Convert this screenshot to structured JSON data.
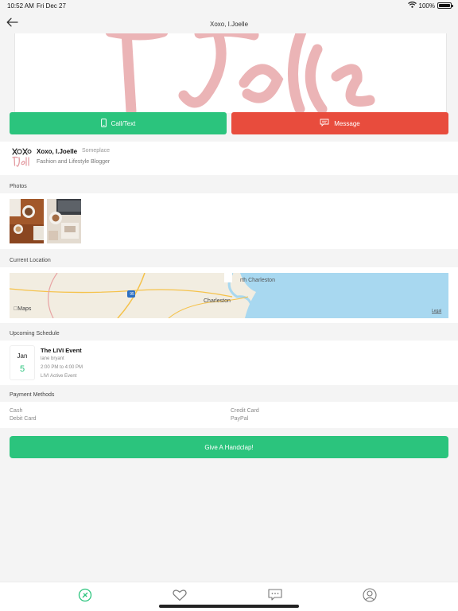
{
  "status_bar": {
    "time": "10:52 AM",
    "date": "Fri Dec 27",
    "battery": "100%",
    "battery_level": 1.0
  },
  "nav": {
    "title": "Xoxo, I.Joelle",
    "back_icon": "arrow-left-icon"
  },
  "hero": {
    "script_text": "I.Joelle",
    "color": "#e9a6a8"
  },
  "actions": {
    "call_label": "Call/Text",
    "call_icon": "phone-icon",
    "call_color": "#2bc47d",
    "message_label": "Message",
    "message_icon": "chat-bubble-icon",
    "message_color": "#e84c3d"
  },
  "profile": {
    "name": "Xoxo, I.Joelle",
    "location": "Someplace",
    "description": "Fashion and Lifestyle Blogger",
    "avatar_logo_top": "XOXO,",
    "avatar_logo_script": "I.Joelle"
  },
  "photos": {
    "header": "Photos",
    "items": [
      "desk-coffee-photo",
      "laptop-desk-photo"
    ]
  },
  "location": {
    "header": "Current Location",
    "map_labels": {
      "city_north": "rth Charleston",
      "city": "Charleston",
      "interstate": "95",
      "brand": "Maps",
      "legal": "Legal"
    }
  },
  "schedule": {
    "header": "Upcoming Schedule",
    "events": [
      {
        "month": "Jan",
        "day": "5",
        "title": "The LIVI Event",
        "venue": "lane bryant",
        "time": "2:00 PM to 4:00 PM",
        "type": "LIVI Active Event"
      }
    ]
  },
  "payment": {
    "header": "Payment Methods",
    "methods": [
      "Cash",
      "Credit Card",
      "Debit Card",
      "PayPal"
    ]
  },
  "handclap": {
    "label": "Give A Handclap!",
    "color": "#2bc47d"
  },
  "tabs": [
    "compass-icon",
    "heart-icon",
    "chat-icon",
    "profile-icon"
  ],
  "colors": {
    "accent": "#2bc47d",
    "danger": "#e84c3d",
    "background": "#f4f4f4"
  }
}
